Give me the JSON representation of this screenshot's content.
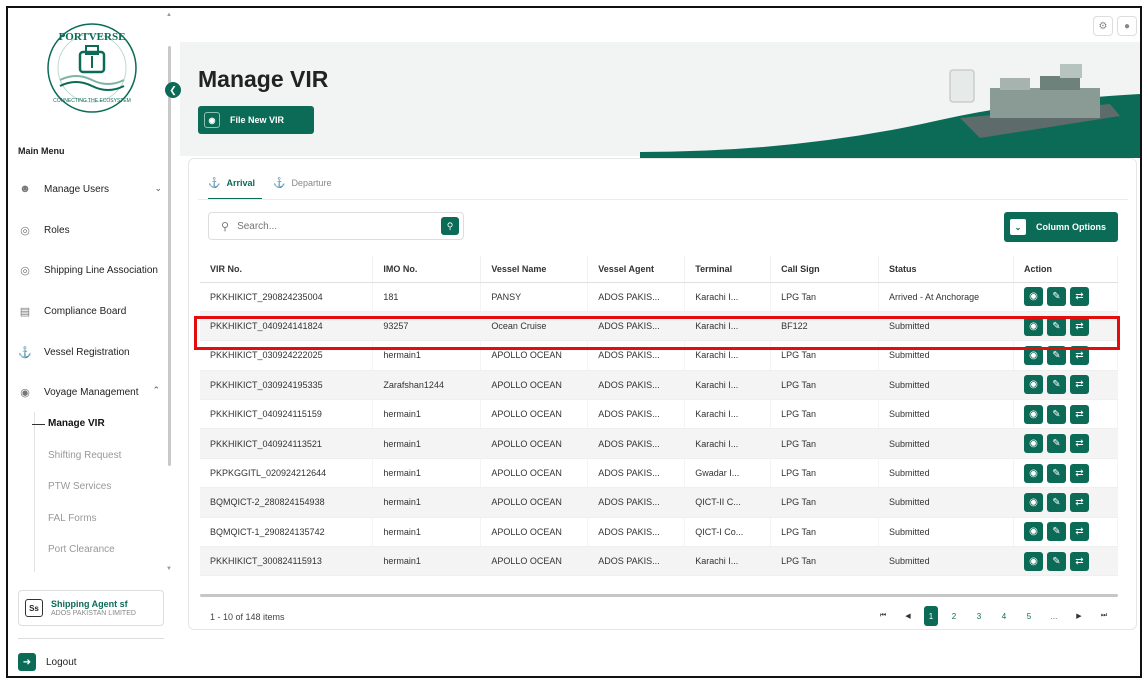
{
  "colors": {
    "primary": "#0b6b57",
    "highlight": "#e30d0d"
  },
  "logo": {
    "text_top": "PORTVERSE",
    "text_bottom": "CONNECTING THE ECOSYSTEM"
  },
  "sidebar": {
    "menu_title": "Main Menu",
    "items": [
      {
        "label": "Manage Users",
        "icon": "user-icon",
        "expandable": true
      },
      {
        "label": "Roles",
        "icon": "roles-icon"
      },
      {
        "label": "Shipping Line Association",
        "icon": "association-icon"
      },
      {
        "label": "Compliance Board",
        "icon": "document-icon"
      },
      {
        "label": "Vessel Registration",
        "icon": "ship-icon"
      },
      {
        "label": "Voyage Management",
        "icon": "voyage-icon",
        "expanded": true
      }
    ],
    "sub_items": [
      {
        "label": "Manage VIR",
        "active": true
      },
      {
        "label": "Shifting Request"
      },
      {
        "label": "PTW Services"
      },
      {
        "label": "FAL Forms"
      },
      {
        "label": "Port Clearance"
      }
    ],
    "user": {
      "initials": "Ss",
      "name": "Shipping Agent sf",
      "org": "ADOS PAKISTAN LIMITED"
    },
    "logout": "Logout"
  },
  "header": {
    "title": "Manage VIR",
    "file_button": "File New VIR"
  },
  "tabs": [
    {
      "label": "Arrival",
      "active": true
    },
    {
      "label": "Departure",
      "active": false
    }
  ],
  "search": {
    "placeholder": "Search..."
  },
  "column_options": "Column Options",
  "table": {
    "columns": [
      "VIR No.",
      "IMO No.",
      "Vessel Name",
      "Vessel Agent",
      "Terminal",
      "Call Sign",
      "Status",
      "Action"
    ],
    "rows": [
      [
        "PKKHIKICT_290824235004",
        "181",
        "PANSY",
        "ADOS PAKIS...",
        "Karachi I...",
        "LPG Tan",
        "Arrived - At Anchorage"
      ],
      [
        "PKKHIKICT_040924141824",
        "93257",
        "Ocean Cruise",
        "ADOS PAKIS...",
        "Karachi I...",
        "BF122",
        "Submitted"
      ],
      [
        "PKKHIKICT_030924222025",
        "hermain1",
        "APOLLO OCEAN",
        "ADOS PAKIS...",
        "Karachi I...",
        "LPG Tan",
        "Submitted"
      ],
      [
        "PKKHIKICT_030924195335",
        "Zarafshan1244",
        "APOLLO OCEAN",
        "ADOS PAKIS...",
        "Karachi I...",
        "LPG Tan",
        "Submitted"
      ],
      [
        "PKKHIKICT_040924115159",
        "hermain1",
        "APOLLO OCEAN",
        "ADOS PAKIS...",
        "Karachi I...",
        "LPG Tan",
        "Submitted"
      ],
      [
        "PKKHIKICT_040924113521",
        "hermain1",
        "APOLLO OCEAN",
        "ADOS PAKIS...",
        "Karachi I...",
        "LPG Tan",
        "Submitted"
      ],
      [
        "PKPKGGITL_020924212644",
        "hermain1",
        "APOLLO OCEAN",
        "ADOS PAKIS...",
        "Gwadar I...",
        "LPG Tan",
        "Submitted"
      ],
      [
        "BQMQICT-2_280824154938",
        "hermain1",
        "APOLLO OCEAN",
        "ADOS PAKIS...",
        "QICT-II C...",
        "LPG Tan",
        "Submitted"
      ],
      [
        "BQMQICT-1_290824135742",
        "hermain1",
        "APOLLO OCEAN",
        "ADOS PAKIS...",
        "QICT-I Co...",
        "LPG Tan",
        "Submitted"
      ],
      [
        "PKKHIKICT_300824115913",
        "hermain1",
        "APOLLO OCEAN",
        "ADOS PAKIS...",
        "Karachi I...",
        "LPG Tan",
        "Submitted"
      ]
    ]
  },
  "pagination": {
    "summary": "1 - 10 of 148 items",
    "pages": [
      "1",
      "2",
      "3",
      "4",
      "5",
      "..."
    ],
    "current": "1",
    "first": "⏮",
    "prev": "◀",
    "next": "▶",
    "last": "⏭"
  }
}
